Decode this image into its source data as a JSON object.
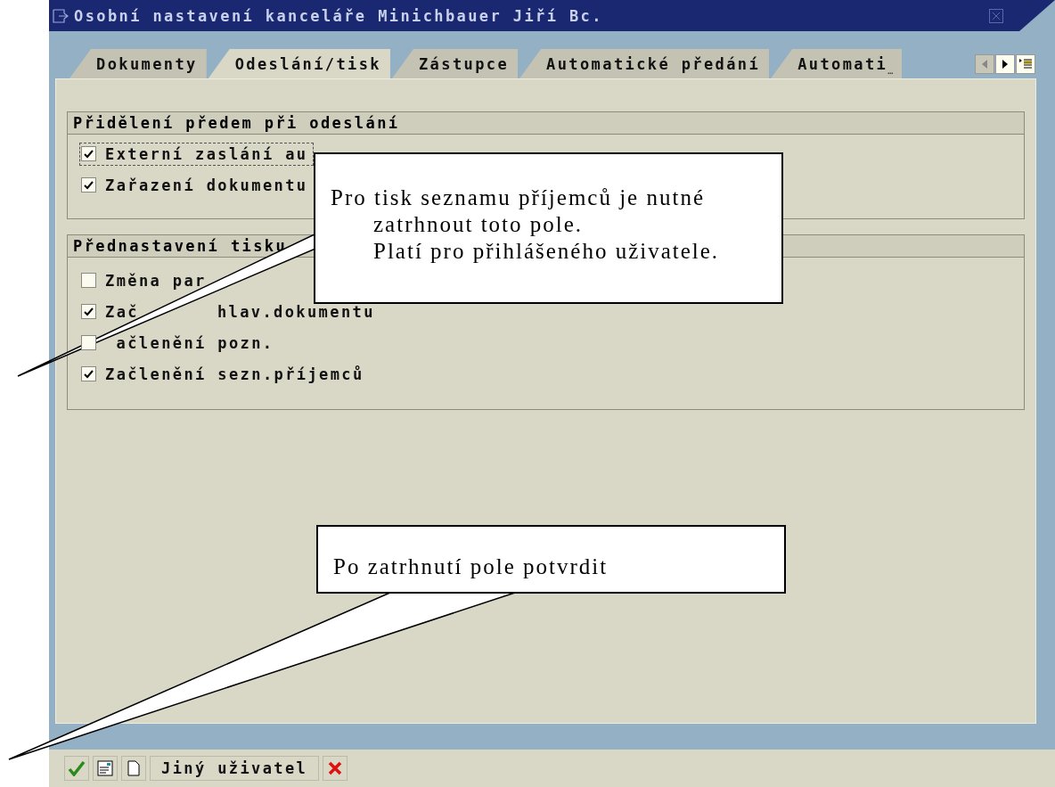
{
  "window": {
    "title": "Osobní nastavení kanceláře Minichbauer Jiří Bc."
  },
  "tabs": [
    {
      "label": "Dokumenty",
      "selected": false
    },
    {
      "label": "Odeslání/tisk",
      "selected": true
    },
    {
      "label": "Zástupce",
      "selected": false
    },
    {
      "label": "Automatické předání",
      "selected": false
    },
    {
      "label": "Automati",
      "ellipsis": "…",
      "selected": false
    }
  ],
  "groups": [
    {
      "title": "Přidělení předem při odeslání",
      "items": [
        {
          "label": "Externí zaslání au",
          "checked": true,
          "focused": true
        },
        {
          "label": "Zařazení dokumentu",
          "checked": true,
          "focused": false
        }
      ]
    },
    {
      "title": "Přednastavení tisku",
      "items": [
        {
          "label": "Změna par",
          "checked": false,
          "focused": false
        },
        {
          "label": "Zač",
          "label_tail": "hlav.dokumentu",
          "checked": true,
          "focused": false
        },
        {
          "label": "ačlenění pozn.",
          "hidden_start": true,
          "checked": false,
          "focused": false
        },
        {
          "label": "Začlenění sezn.příjemců",
          "checked": true,
          "focused": false
        }
      ]
    }
  ],
  "toolbar": {
    "text_button": "Jiný uživatel"
  },
  "callouts": [
    {
      "lines": [
        "Pro tisk seznamu příjemců je nutné",
        "zatrhnout toto pole.",
        "Platí pro přihlášeného uživatele."
      ]
    },
    {
      "lines": [
        "Po zatrhnutí pole potvrdit"
      ]
    }
  ]
}
